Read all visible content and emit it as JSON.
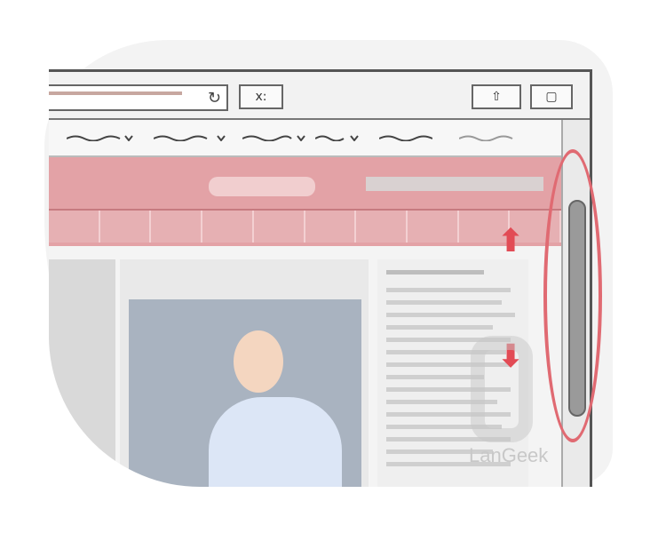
{
  "toolbar": {
    "refresh_glyph": "↻",
    "close_tab_label": "x:",
    "share_glyph": "⇧",
    "window_glyph": "▢"
  },
  "colors": {
    "banner": "#e3a2a6",
    "highlight": "#e06a72",
    "scrollbar_thumb": "#9a9a9a"
  },
  "icons": [
    "refresh-icon",
    "close-tab-icon",
    "share-icon",
    "window-icon",
    "up-arrow-icon",
    "down-arrow-icon"
  ],
  "arrows": {
    "up": "⬆",
    "down": "⬇"
  },
  "watermark": {
    "text": "LanGeek"
  }
}
